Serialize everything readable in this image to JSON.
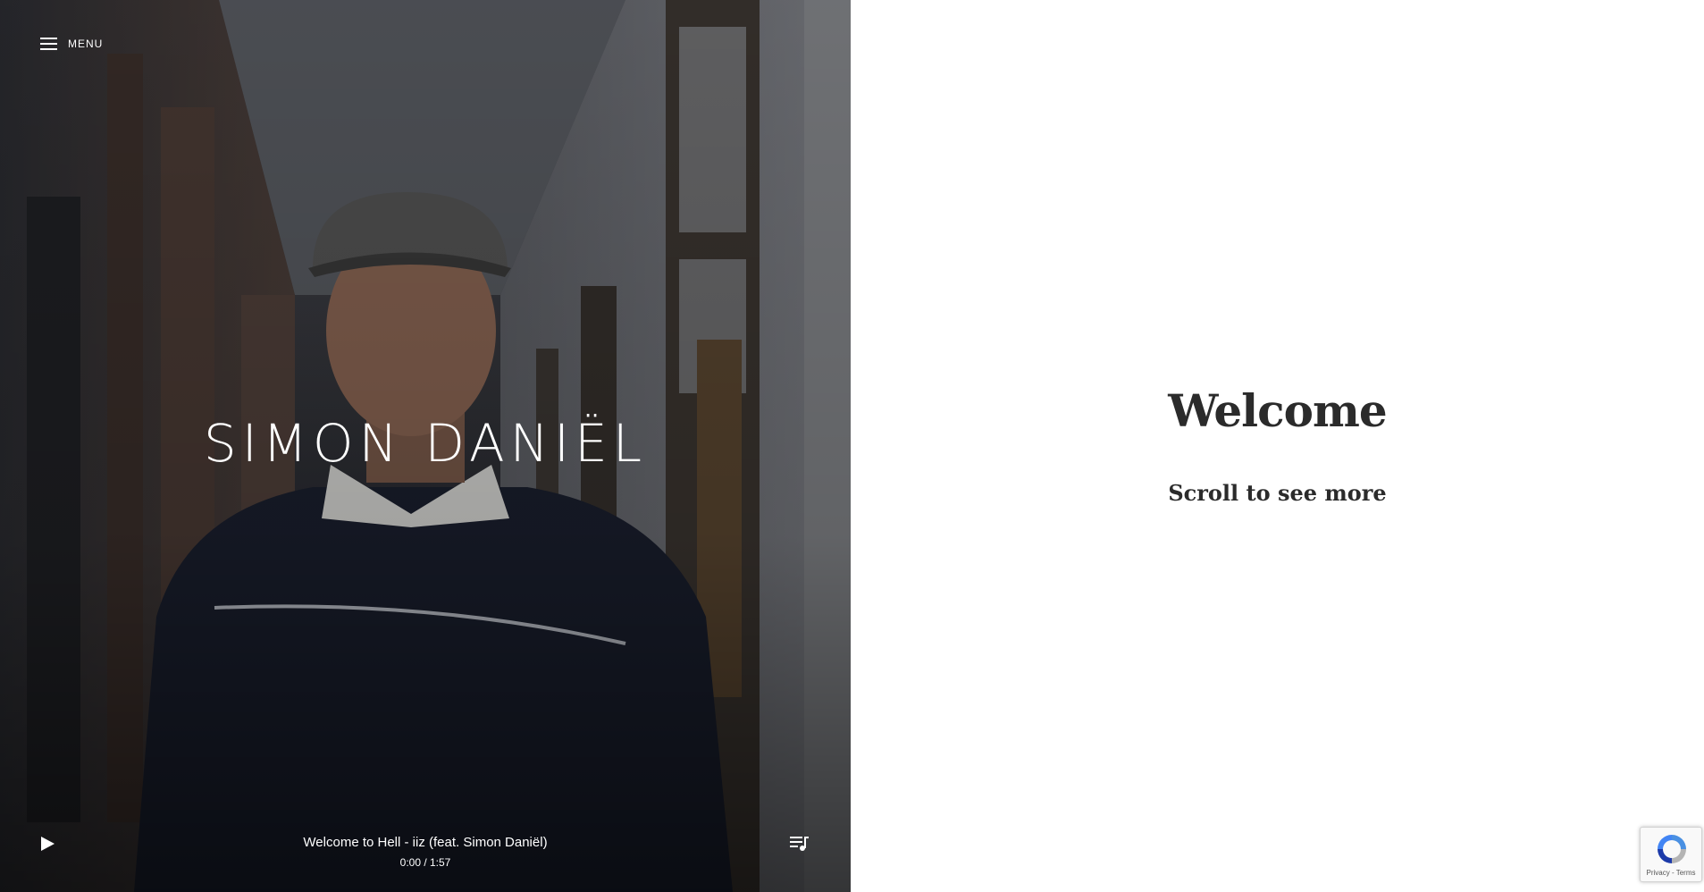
{
  "menu": {
    "label": "MENU"
  },
  "hero": {
    "artist_name": "SIMON DANIËL"
  },
  "player": {
    "track_title": "Welcome to Hell - iiz (feat. Simon Daniël)",
    "time_display": "0:00 / 1:57"
  },
  "main": {
    "heading": "Welcome",
    "subheading": "Scroll to see more"
  },
  "recaptcha": {
    "links": "Privacy - Terms"
  },
  "icons": {
    "menu": "hamburger-icon",
    "play": "play-icon",
    "playlist": "playlist-icon",
    "recaptcha": "recaptcha-logo"
  },
  "colors": {
    "heading_text": "#2b2b2b",
    "hero_text": "#ffffff",
    "hero_overlay": "#1b1c22"
  }
}
